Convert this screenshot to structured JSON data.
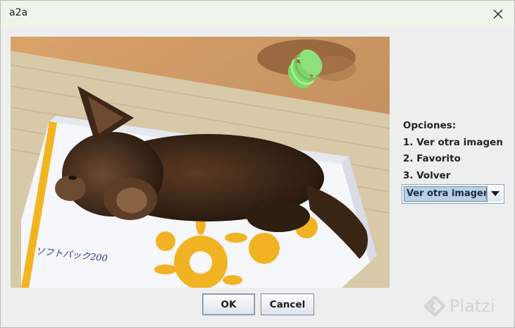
{
  "window": {
    "title": "a2a"
  },
  "photo": {
    "box_label": "ソフトパック200"
  },
  "options": {
    "heading": "Opciones:",
    "items": [
      "1. Ver otra imagen",
      "2. Favorito",
      "3. Volver"
    ]
  },
  "combo": {
    "selected": "Ver otra imagen"
  },
  "buttons": {
    "ok": "OK",
    "cancel": "Cancel"
  },
  "watermark": {
    "text": "Platzi"
  },
  "icons": {
    "close": "close-icon",
    "dropdown": "chevron-down-icon",
    "watermark_logo": "platzi-logo-icon"
  }
}
